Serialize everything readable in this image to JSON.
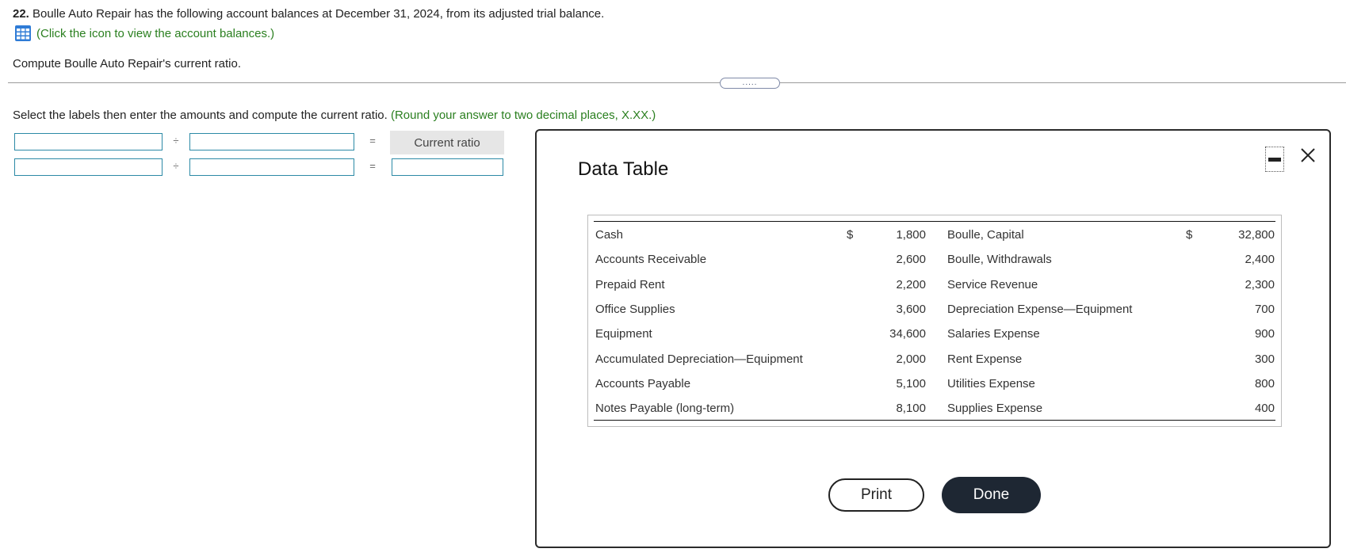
{
  "question": {
    "number": "22.",
    "text": "Boulle Auto Repair has the following account balances at December 31, 2024, from its adjusted trial balance.",
    "icon_link": "(Click the icon to view the account balances.)",
    "compute": "Compute Boulle Auto Repair's current ratio."
  },
  "resize_handle": ".....",
  "instruction": {
    "text": "Select the labels then enter the amounts and compute the current ratio.",
    "hint": "(Round your answer to two decimal places, X.XX.)"
  },
  "formula": {
    "divide_symbol": "÷",
    "equals_symbol": "=",
    "result_label": "Current ratio",
    "row1": {
      "numerator": "",
      "denominator": ""
    },
    "row2": {
      "numerator": "",
      "denominator": "",
      "result": ""
    }
  },
  "dialog": {
    "title": "Data Table",
    "currency_symbol": "$",
    "rows": [
      {
        "left_label": "Cash",
        "left_value": "1,800",
        "right_label": "Boulle, Capital",
        "right_value": "32,800"
      },
      {
        "left_label": "Accounts Receivable",
        "left_value": "2,600",
        "right_label": "Boulle, Withdrawals",
        "right_value": "2,400"
      },
      {
        "left_label": "Prepaid Rent",
        "left_value": "2,200",
        "right_label": "Service Revenue",
        "right_value": "2,300"
      },
      {
        "left_label": "Office Supplies",
        "left_value": "3,600",
        "right_label": "Depreciation Expense—Equipment",
        "right_value": "700"
      },
      {
        "left_label": "Equipment",
        "left_value": "34,600",
        "right_label": "Salaries Expense",
        "right_value": "900"
      },
      {
        "left_label": "Accumulated Depreciation—Equipment",
        "left_value": "2,000",
        "right_label": "Rent Expense",
        "right_value": "300"
      },
      {
        "left_label": "Accounts Payable",
        "left_value": "5,100",
        "right_label": "Utilities Expense",
        "right_value": "800"
      },
      {
        "left_label": "Notes Payable (long-term)",
        "left_value": "8,100",
        "right_label": "Supplies Expense",
        "right_value": "400"
      }
    ],
    "print_label": "Print",
    "done_label": "Done"
  },
  "colors": {
    "hint_green": "#2a7f1f",
    "field_border": "#2c8aa6",
    "done_bg": "#1e2733",
    "icon_blue": "#2e7bd6"
  }
}
